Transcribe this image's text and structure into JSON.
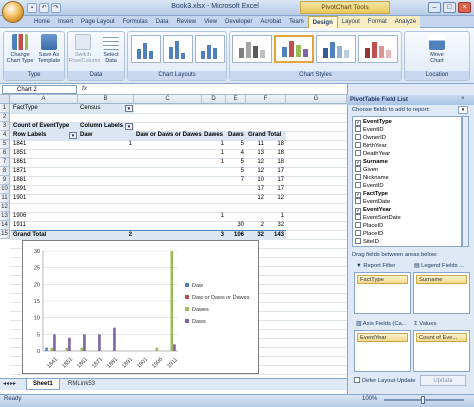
{
  "window": {
    "title": "Book3.xlsx - Microsoft Excel",
    "context_title": "PivotChart Tools"
  },
  "qat": [
    "save",
    "undo",
    "redo"
  ],
  "tabs": [
    "Home",
    "Insert",
    "Page Layout",
    "Formulas",
    "Data",
    "Review",
    "View",
    "Developer",
    "Acrobat",
    "Team",
    "Design",
    "Layout",
    "Format",
    "Analyze"
  ],
  "active_tab": "Design",
  "ribbon": {
    "type_group": {
      "label": "Type",
      "change": "Change Chart Type",
      "save_template": "Save As Template"
    },
    "data_group": {
      "label": "Data",
      "switch": "Switch Row/Column",
      "select": "Select Data"
    },
    "layouts_group": {
      "label": "Chart Layouts"
    },
    "styles_group": {
      "label": "Chart Styles"
    },
    "location_group": {
      "label": "Location",
      "move": "Move Chart"
    }
  },
  "name_box": "Chart 2",
  "fx": "fx",
  "columns": [
    "A",
    "B",
    "C",
    "D",
    "E",
    "F",
    "G"
  ],
  "rows": [
    "1",
    "2",
    "3",
    "4",
    "5",
    "6",
    "7",
    "8",
    "9",
    "10",
    "11",
    "12",
    "13",
    "14",
    "15"
  ],
  "pivot_table": {
    "filter_field": "FactType",
    "filter_value": "Census",
    "values_label": "Count of EventType",
    "columns_label": "Column Labels",
    "row_labels": "Row Labels",
    "col_headers": [
      "Daw",
      "Daw or Daws or Dawes",
      "Dawes",
      "Daws",
      "Grand Total"
    ],
    "data": [
      {
        "year": "1841",
        "vals": [
          "1",
          "",
          "1",
          "5",
          "11",
          "18"
        ]
      },
      {
        "year": "1851",
        "vals": [
          "",
          "",
          "1",
          "4",
          "13",
          "18"
        ]
      },
      {
        "year": "1861",
        "vals": [
          "",
          "",
          "1",
          "5",
          "12",
          "18"
        ]
      },
      {
        "year": "1871",
        "vals": [
          "",
          "",
          "",
          "5",
          "12",
          "17"
        ]
      },
      {
        "year": "1881",
        "vals": [
          "",
          "",
          "",
          "7",
          "10",
          "17"
        ]
      },
      {
        "year": "1891",
        "vals": [
          "",
          "",
          "",
          "",
          "17",
          "17"
        ]
      },
      {
        "year": "1901",
        "vals": [
          "",
          "",
          "",
          "",
          "12",
          "12"
        ]
      },
      {
        "year": "1906",
        "vals": [
          "",
          "",
          "1",
          "",
          "",
          "1"
        ]
      },
      {
        "year": "1911",
        "vals": [
          "",
          "",
          "",
          "30",
          "2",
          "32"
        ]
      }
    ],
    "grand_total": {
      "label": "Grand Total",
      "vals": [
        "2",
        "",
        "3",
        "106",
        "32",
        "143"
      ]
    }
  },
  "chart_data": {
    "type": "bar",
    "categories": [
      "1841",
      "1851",
      "1861",
      "1871",
      "1881",
      "1891",
      "1901",
      "1906",
      "1911"
    ],
    "ylim": [
      0,
      30
    ],
    "yticks": [
      "0",
      "5",
      "10",
      "15",
      "20",
      "25",
      "30"
    ],
    "series": [
      {
        "name": "Daw",
        "color": "#4f81bd",
        "values": [
          1,
          0,
          0,
          0,
          0,
          0,
          0,
          0,
          0
        ]
      },
      {
        "name": "Daw or Daws or Dawes",
        "color": "#c0504d",
        "values": [
          0,
          0,
          0,
          0,
          0,
          0,
          0,
          0,
          0
        ]
      },
      {
        "name": "Dawes",
        "color": "#9bbb59",
        "values": [
          1,
          1,
          1,
          0,
          0,
          0,
          0,
          1,
          30
        ]
      },
      {
        "name": "Daws",
        "color": "#8064a2",
        "values": [
          5,
          4,
          5,
          5,
          7,
          0,
          0,
          0,
          2
        ]
      }
    ]
  },
  "pivot_pane": {
    "title": "PivotTable Field List",
    "choose": "Choose fields to add to report:",
    "fields": [
      {
        "name": "EventType",
        "checked": true
      },
      {
        "name": "EventID",
        "checked": false
      },
      {
        "name": "OwnerID",
        "checked": false
      },
      {
        "name": "BirthYear",
        "checked": false
      },
      {
        "name": "DeathYear",
        "checked": false
      },
      {
        "name": "Surname",
        "checked": true
      },
      {
        "name": "Given",
        "checked": false
      },
      {
        "name": "Nickname",
        "checked": false
      },
      {
        "name": "EventID",
        "checked": false
      },
      {
        "name": "FactType",
        "checked": true
      },
      {
        "name": "EventDate",
        "checked": false
      },
      {
        "name": "EventYear",
        "checked": true
      },
      {
        "name": "EventSortDate",
        "checked": false
      },
      {
        "name": "PlaceID",
        "checked": false
      },
      {
        "name": "PlaceID",
        "checked": false
      },
      {
        "name": "SiteID",
        "checked": false
      }
    ],
    "drag_label": "Drag fields between areas below:",
    "report_filter": "Report Filter",
    "legend_fields": "Legend Fields ...",
    "axis_fields": "Axis Fields (Ca...",
    "values": "Values",
    "filter_chip": "FactType",
    "legend_chip": "Surname",
    "axis_chip": "EventYear",
    "values_chip": "Count of Eve...",
    "defer": "Defer Layout Update",
    "update": "Update"
  },
  "sheet_tabs": [
    "Sheet1",
    "RMLink53"
  ],
  "status": {
    "ready": "Ready",
    "zoom": "100%"
  }
}
